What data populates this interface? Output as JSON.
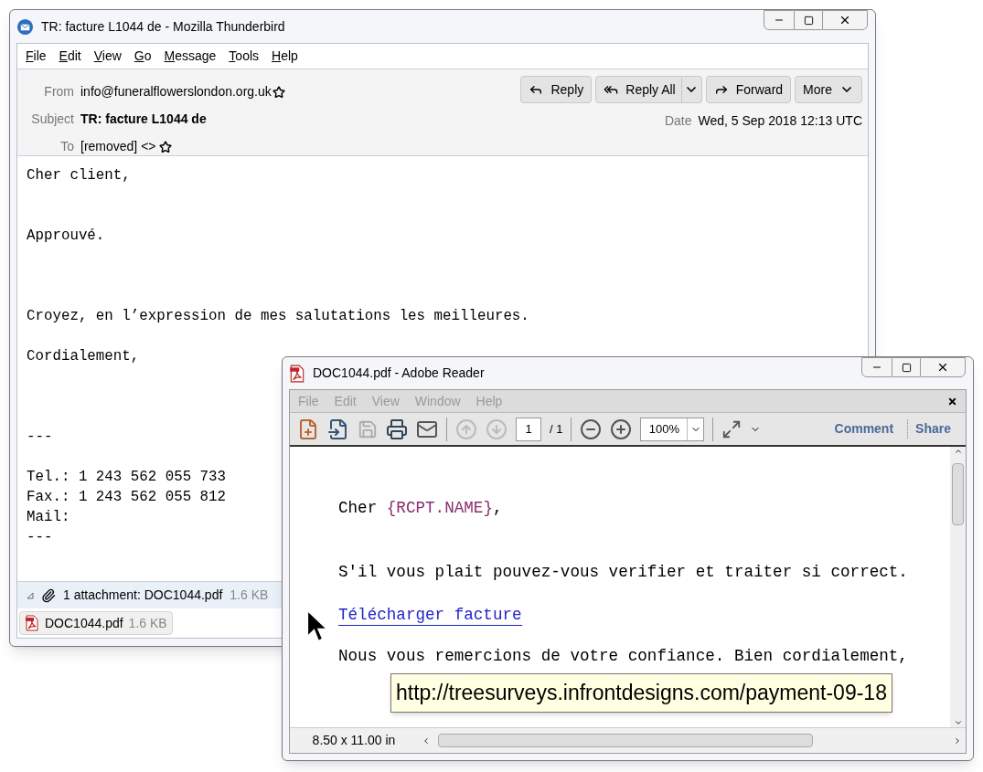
{
  "mail_window": {
    "title": "TR: facture L1044 de - Mozilla Thunderbird",
    "menu": [
      {
        "label": "File"
      },
      {
        "label": "Edit"
      },
      {
        "label": "View"
      },
      {
        "label": "Go"
      },
      {
        "label": "Message"
      },
      {
        "label": "Tools"
      },
      {
        "label": "Help"
      }
    ],
    "header": {
      "from_label": "From",
      "from": "info@funeralflowerslondon.org.uk",
      "subject_label": "Subject",
      "subject": "TR: facture L1044 de",
      "to_label": "To",
      "to": "[removed] <>",
      "date_label": "Date",
      "date": "Wed, 5 Sep 2018 12:13 UTC"
    },
    "actions": [
      {
        "label": "Reply",
        "kind": "reply"
      },
      {
        "label": "Reply All",
        "kind": "reply_all"
      },
      {
        "label": "Forward",
        "kind": "forward"
      },
      {
        "label": "More",
        "kind": "more"
      }
    ],
    "body": [
      [
        "Cher client,"
      ],
      [
        "Approuvé."
      ],
      [
        "Croyez, en l’expression de mes salutations les meilleures."
      ],
      [
        "Cordialement,"
      ],
      [
        "---"
      ],
      [
        "Tel.: 1 243 562 055 733",
        "Fax.: 1 243 562 055 812",
        "Mail:",
        "---"
      ]
    ],
    "attachment_bar": {
      "summary": "1 attachment: DOC1044.pdf",
      "size": "1.6 KB"
    },
    "attachments": [
      {
        "name": "DOC1044.pdf",
        "size": "1.6 KB"
      }
    ]
  },
  "reader_window": {
    "title": "DOC1044.pdf - Adobe Reader",
    "menu": [
      {
        "label": "File",
        "disabled": true
      },
      {
        "label": "Edit",
        "disabled": true
      },
      {
        "label": "View",
        "disabled": true
      },
      {
        "label": "Window",
        "disabled": true
      },
      {
        "label": "Help",
        "disabled": true
      }
    ],
    "page": "1",
    "page_total": "/ 1",
    "zoom": "100%",
    "tools": [
      {
        "label": "Comment"
      },
      {
        "label": "Share"
      }
    ],
    "document": {
      "greeting": {
        "prefix": "Cher ",
        "variable": "{RCPT.NAME}",
        "suffix": ","
      },
      "request": "S'il vous plait pouvez-vous verifier et traiter si correct.",
      "link": "Télécharger facture",
      "closing": "Nous vous remercions de votre confiance. Bien cordialement,"
    },
    "tooltip": "http://treesurveys.infrontdesigns.com/payment-09-18",
    "page_size": "8.50 x 11.00 in"
  }
}
